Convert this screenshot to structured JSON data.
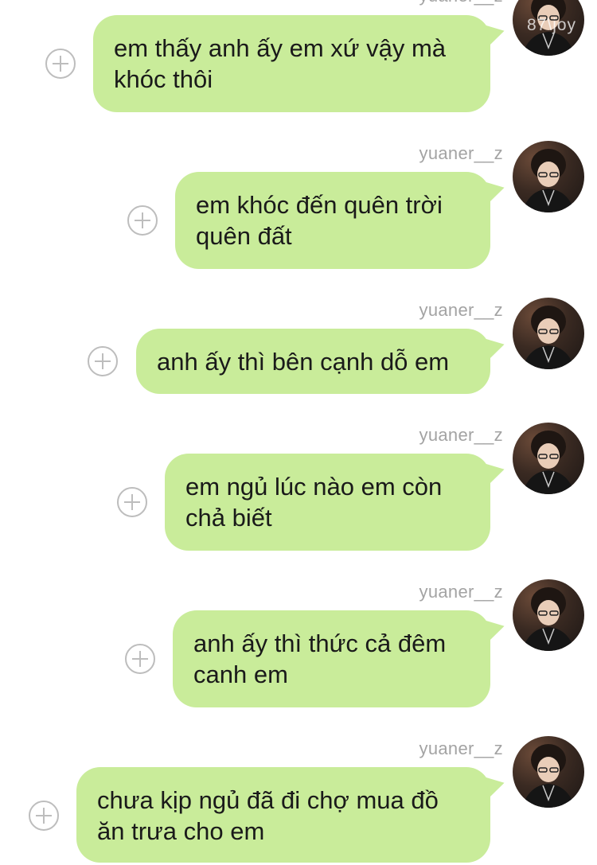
{
  "watermark": "87\\joy",
  "messages": [
    {
      "sender": "yuaner__z",
      "text": "em thấy anh ấy em xứ vậy mà\nkhóc thôi"
    },
    {
      "sender": "yuaner__z",
      "text": "em khóc đến quên trời\nquên đất"
    },
    {
      "sender": "yuaner__z",
      "text": "anh ấy thì bên cạnh dỗ em"
    },
    {
      "sender": "yuaner__z",
      "text": "em ngủ lúc nào em còn\nchả biết"
    },
    {
      "sender": "yuaner__z",
      "text": "anh ấy thì thức cả đêm\ncanh em"
    },
    {
      "sender": "yuaner__z",
      "text": "chưa kịp ngủ đã đi chợ mua đồ\năn trưa cho em"
    }
  ],
  "colors": {
    "bubble": "#c9ec9a",
    "sender": "#a3a3a3",
    "add_button": "#bdbdbd"
  },
  "icons": {
    "add": "plus-circle-icon"
  }
}
